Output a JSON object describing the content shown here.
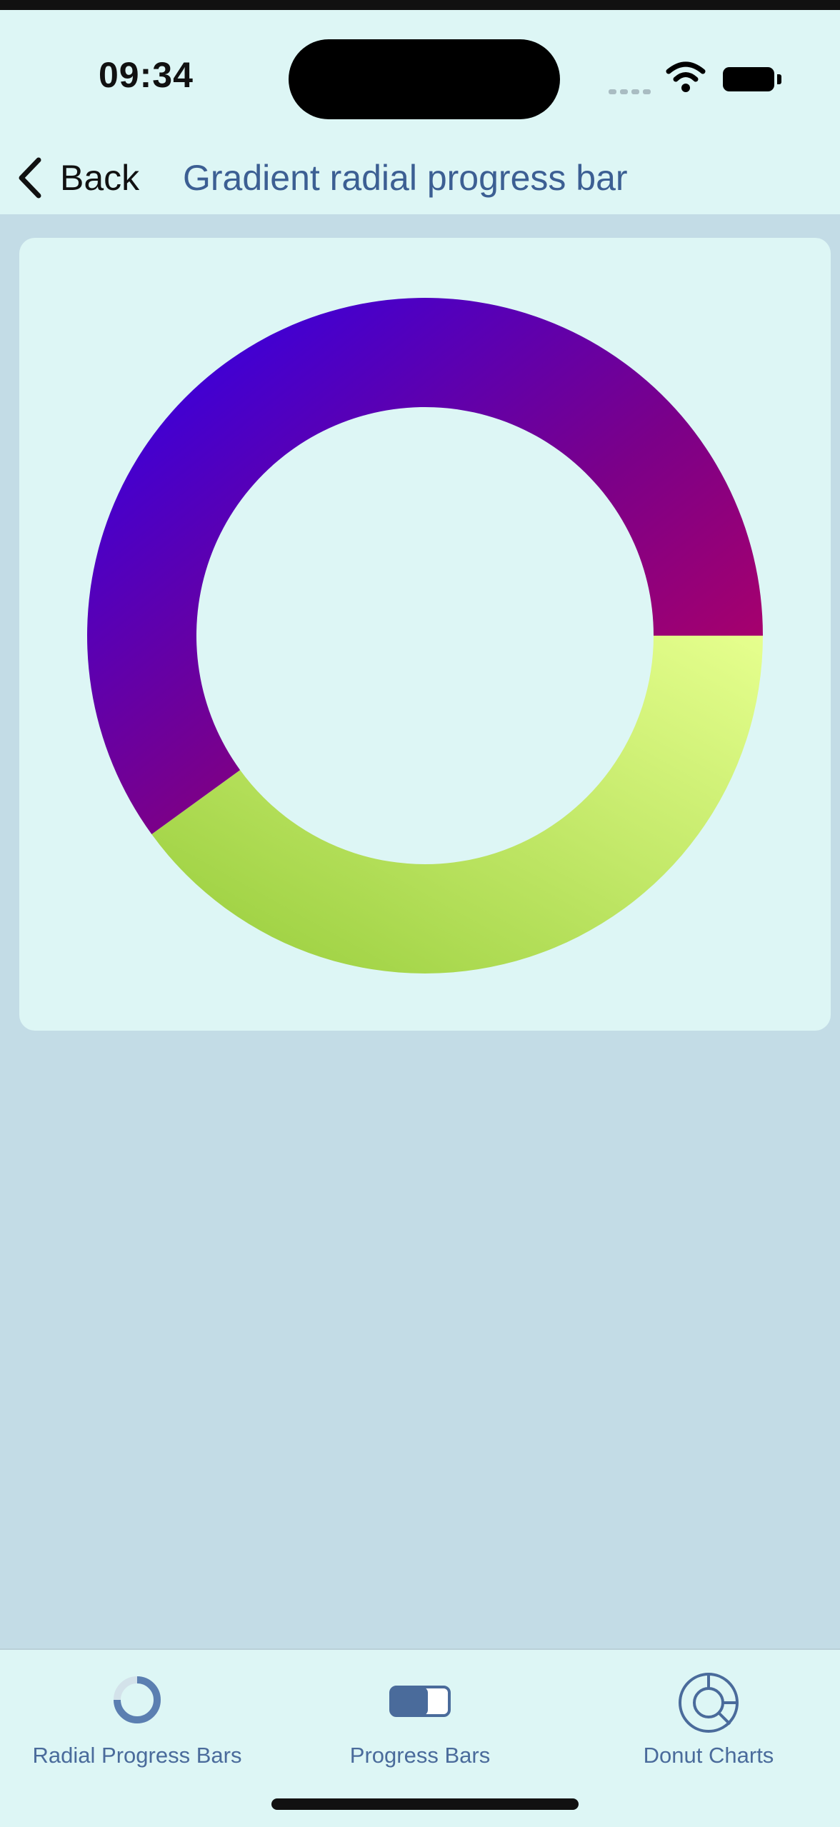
{
  "status_bar": {
    "time": "09:34"
  },
  "nav": {
    "back_label": "Back",
    "title": "Gradient radial progress bar"
  },
  "chart_data": {
    "type": "radial-progress",
    "value": 0.6,
    "start_angle_deg": 0,
    "direction": "counter-clockwise"
  },
  "colors": {
    "gradient_start": "#2a00f0",
    "gradient_mid": "#7b0089",
    "gradient_end": "#c4005a",
    "remainder_start": "#e6ff8e",
    "remainder_end": "#96cc3a",
    "accent": "#3c5f93"
  },
  "tabs": [
    {
      "label": "Radial Progress Bars",
      "icon": "radial-progress-icon"
    },
    {
      "label": "Progress Bars",
      "icon": "progress-bar-icon"
    },
    {
      "label": "Donut Charts",
      "icon": "donut-chart-icon"
    }
  ]
}
